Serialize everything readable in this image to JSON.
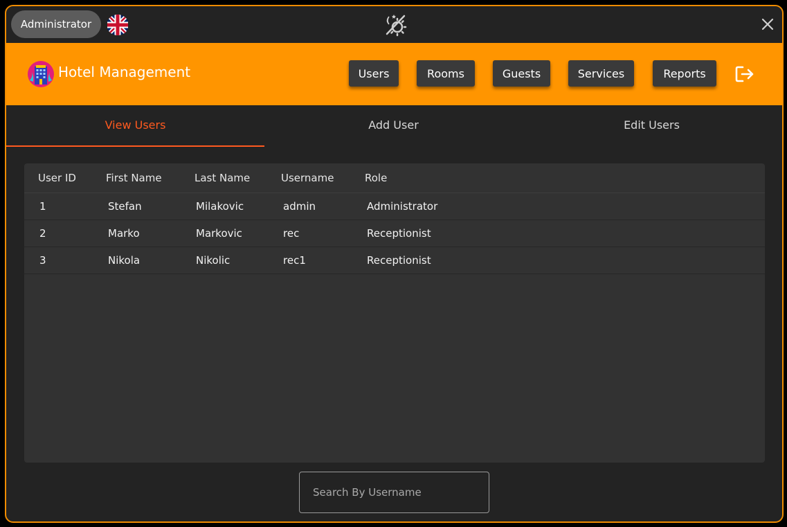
{
  "titlebar": {
    "user_role": "Administrator"
  },
  "header": {
    "app_title": "Hotel Management",
    "nav": [
      "Users",
      "Rooms",
      "Guests",
      "Services",
      "Reports"
    ]
  },
  "tabs": [
    {
      "label": "View Users",
      "active": true
    },
    {
      "label": "Add User",
      "active": false
    },
    {
      "label": "Edit Users",
      "active": false
    }
  ],
  "table": {
    "columns": [
      "User ID",
      "First Name",
      "Last Name",
      "Username",
      "Role"
    ],
    "rows": [
      [
        "1",
        "Stefan",
        "Milakovic",
        "admin",
        "Administrator"
      ],
      [
        "2",
        "Marko",
        "Markovic",
        "rec",
        "Receptionist"
      ],
      [
        "3",
        "Nikola",
        "Nikolic",
        "rec1",
        "Receptionist"
      ]
    ]
  },
  "search": {
    "placeholder": "Search By Username",
    "value": ""
  },
  "colors": {
    "accent": "#ff9500",
    "active_tab": "#ff5a1f",
    "background": "#232323",
    "border": "#f08c00"
  },
  "icons": [
    "uk-flag-icon",
    "theme-toggle-icon",
    "close-icon",
    "hotel-logo-icon",
    "logout-icon"
  ]
}
